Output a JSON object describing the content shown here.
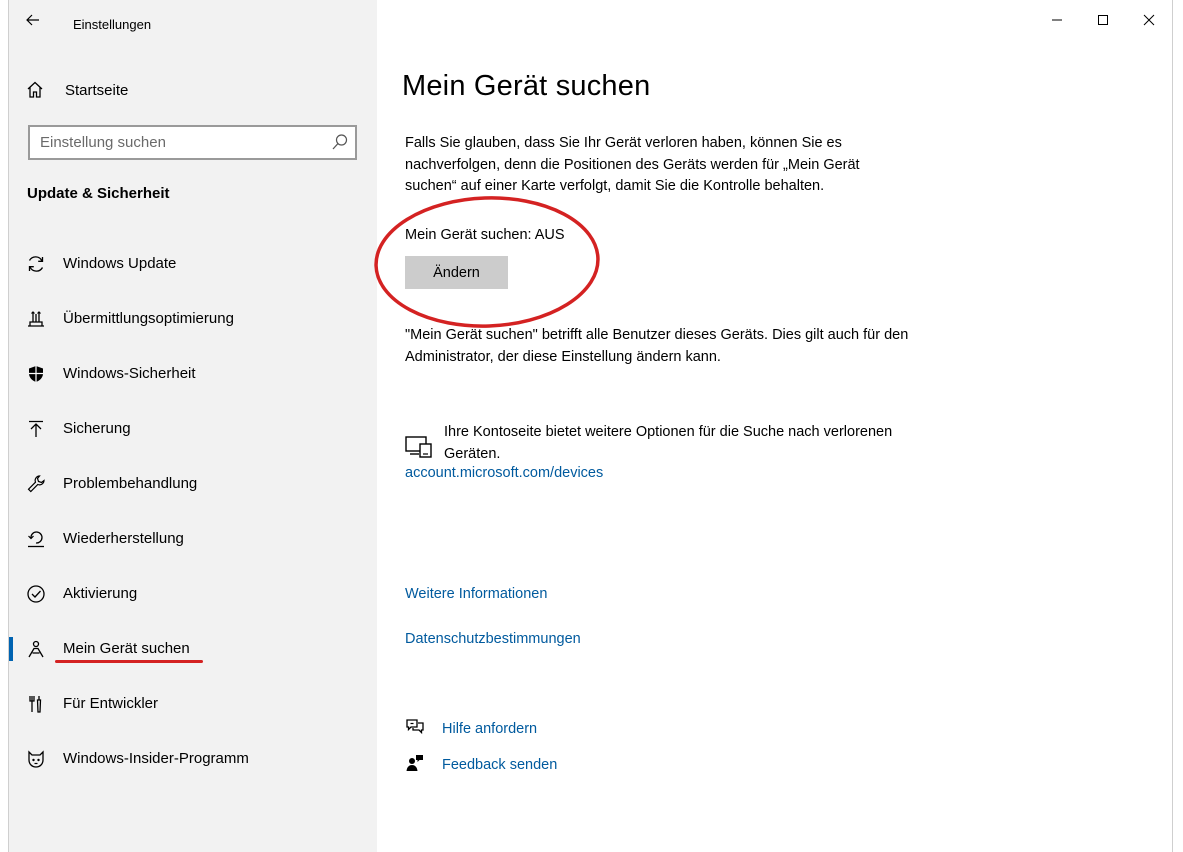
{
  "window": {
    "title": "Einstellungen"
  },
  "sidebar": {
    "home_label": "Startseite",
    "search_placeholder": "Einstellung suchen",
    "section_title": "Update & Sicherheit",
    "items": [
      {
        "label": "Windows Update",
        "icon": "sync-icon"
      },
      {
        "label": "Übermittlungsoptimierung",
        "icon": "delivery-optimization-icon"
      },
      {
        "label": "Windows-Sicherheit",
        "icon": "shield-icon"
      },
      {
        "label": "Sicherung",
        "icon": "backup-arrow-up-icon"
      },
      {
        "label": "Problembehandlung",
        "icon": "wrench-icon"
      },
      {
        "label": "Wiederherstellung",
        "icon": "recovery-icon"
      },
      {
        "label": "Aktivierung",
        "icon": "check-circle-icon"
      },
      {
        "label": "Mein Gerät suchen",
        "icon": "find-device-person-icon",
        "active": true
      },
      {
        "label": "Für Entwickler",
        "icon": "developer-tools-icon"
      },
      {
        "label": "Windows-Insider-Programm",
        "icon": "insider-cat-icon"
      }
    ]
  },
  "main": {
    "title": "Mein Gerät suchen",
    "description": "Falls Sie glauben, dass Sie Ihr Gerät verloren haben, können Sie es nachverfolgen, denn die Positionen des Geräts werden für „Mein Gerät suchen“ auf einer Karte verfolgt, damit Sie die Kontrolle behalten.",
    "status": "Mein Gerät suchen: AUS",
    "change_button": "Ändern",
    "note": "\"Mein Gerät suchen\" betrifft alle Benutzer dieses Geräts. Dies gilt auch für den Administrator, der diese Einstellung ändern kann.",
    "account_text": "Ihre Kontoseite bietet weitere Optionen für die Suche nach verlorenen Geräten.",
    "account_link": "account.microsoft.com/devices",
    "more_info": "Weitere Informationen",
    "privacy": "Datenschutzbestimmungen",
    "help": "Hilfe anfordern",
    "feedback": "Feedback senden"
  },
  "colors": {
    "accent": "#0063b1",
    "link": "#005a9e",
    "annotation_red": "#d42222",
    "sidebar_bg": "#f2f2f2",
    "button_bg": "#cccccc"
  }
}
